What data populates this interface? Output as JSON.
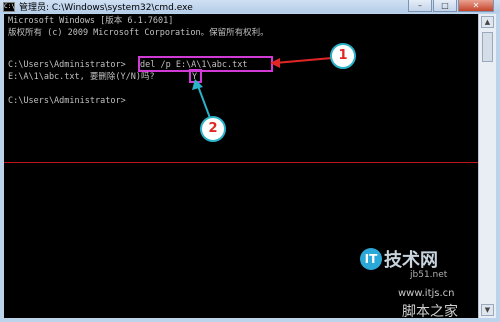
{
  "window": {
    "title": "管理员: C:\\Windows\\system32\\cmd.exe",
    "icon_label": "C:\\",
    "buttons": {
      "minimize": "–",
      "maximize": "□",
      "close": "✕"
    }
  },
  "console": {
    "lines": [
      "Microsoft Windows [版本 6.1.7601]",
      "版权所有 (c) 2009 Microsoft Corporation。保留所有权利。",
      "",
      "C:\\Users\\Administrator>",
      "E:\\A\\1\\abc.txt, 要删除(Y/N)吗? ",
      "",
      "C:\\Users\\Administrator>"
    ],
    "command": "del /p E:\\A\\1\\abc.txt",
    "answer": "Y"
  },
  "callouts": {
    "c1": "1",
    "c2": "2"
  },
  "watermark": {
    "brand": "技术网",
    "site1": "jb51.net",
    "site2": "www.itjs.cn",
    "site3": "脚本之家"
  }
}
